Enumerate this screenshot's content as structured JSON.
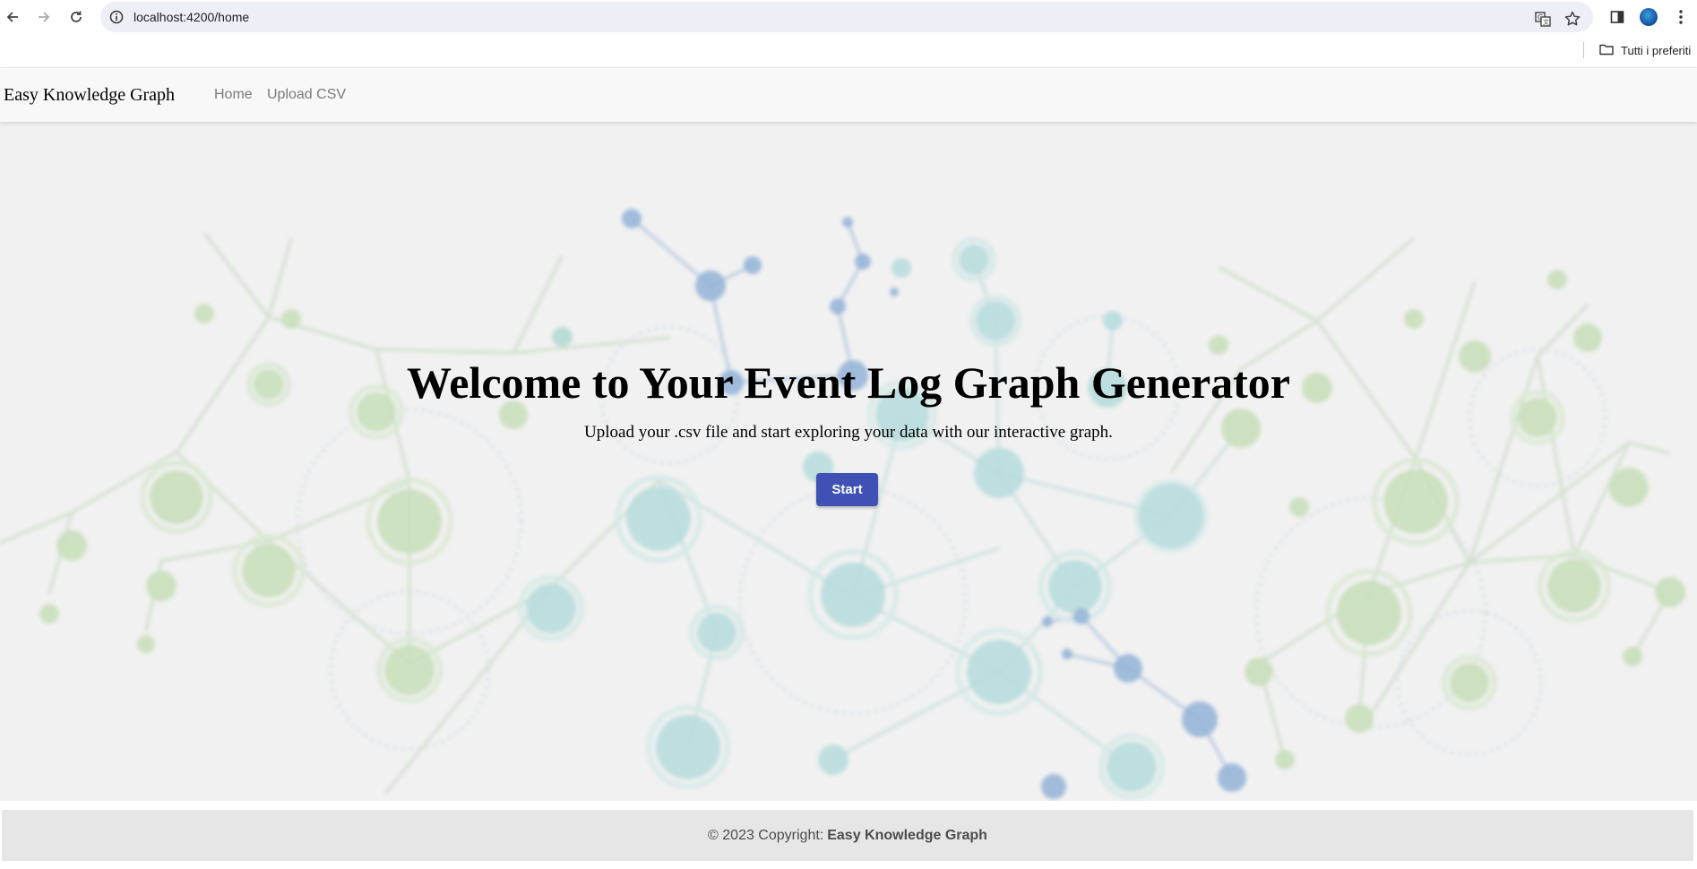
{
  "browser": {
    "url": "localhost:4200/home",
    "bookmarks_folder": "Tutti i preferiti"
  },
  "app": {
    "brand": "Easy Knowledge Graph",
    "nav": [
      {
        "label": "Home"
      },
      {
        "label": "Upload CSV"
      }
    ]
  },
  "hero": {
    "title": "Welcome to Your Event Log Graph Generator",
    "subtitle": "Upload your .csv file and start exploring your data with our interactive graph.",
    "start_label": "Start"
  },
  "footer": {
    "prefix": "© 2023 Copyright:",
    "brand": "Easy Knowledge Graph"
  },
  "colors": {
    "primary_button": "#3f51b5",
    "navbar_bg": "#f8f8f8",
    "footer_bg": "#e6e6e6",
    "node_green": "#c6dfb8",
    "node_teal": "#b6dede",
    "node_blue": "#8fb0d6"
  },
  "icons": [
    "back-arrow-icon",
    "forward-arrow-icon",
    "reload-icon",
    "site-info-icon",
    "translate-icon",
    "star-icon",
    "side-panel-icon",
    "profile-avatar",
    "kebab-menu-icon",
    "folder-icon"
  ]
}
